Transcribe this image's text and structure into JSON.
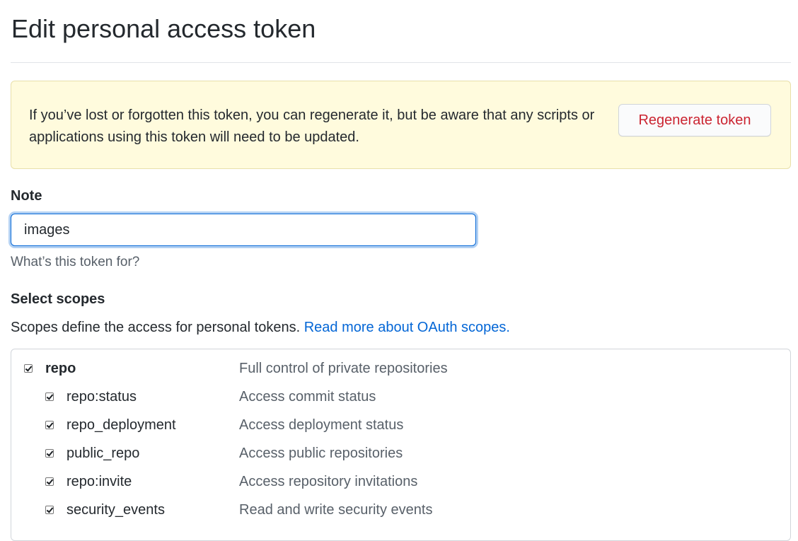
{
  "page": {
    "title": "Edit personal access token"
  },
  "flash": {
    "message": "If you’ve lost or forgotten this token, you can regenerate it, but be aware that any scripts or applications using this token will need to be updated.",
    "regenerate_label": "Regenerate token"
  },
  "note": {
    "label": "Note",
    "value": "images",
    "hint": "What’s this token for?"
  },
  "scopes": {
    "label": "Select scopes",
    "description": "Scopes define the access for personal tokens.",
    "link_text": "Read more about OAuth scopes.",
    "items": [
      {
        "name": "repo",
        "description": "Full control of private repositories",
        "checked": true,
        "level": 0
      },
      {
        "name": "repo:status",
        "description": "Access commit status",
        "checked": true,
        "level": 1
      },
      {
        "name": "repo_deployment",
        "description": "Access deployment status",
        "checked": true,
        "level": 1
      },
      {
        "name": "public_repo",
        "description": "Access public repositories",
        "checked": true,
        "level": 1
      },
      {
        "name": "repo:invite",
        "description": "Access repository invitations",
        "checked": true,
        "level": 1
      },
      {
        "name": "security_events",
        "description": "Read and write security events",
        "checked": true,
        "level": 1
      }
    ]
  },
  "colors": {
    "flash_background": "#fffbdd",
    "danger_text": "#cb2431",
    "link": "#0366d6",
    "focus_border": "#0366d6"
  }
}
